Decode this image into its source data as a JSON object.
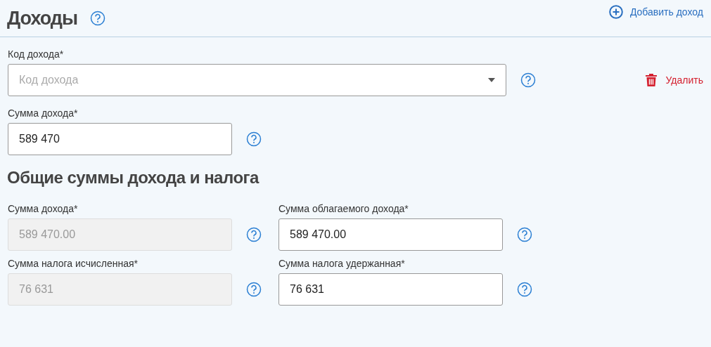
{
  "header": {
    "title": "Доходы",
    "add_button": "Добавить доход"
  },
  "income": {
    "code": {
      "label": "Код дохода*",
      "placeholder": "Код дохода"
    },
    "delete_button": "Удалить",
    "amount": {
      "label": "Сумма дохода*",
      "value": "589 470"
    }
  },
  "totals": {
    "title": "Общие суммы дохода и налога",
    "fields": [
      {
        "label": "Сумма дохода*",
        "value": "589 470.00",
        "disabled": true
      },
      {
        "label": "Сумма облагаемого дохода*",
        "value": "589 470.00",
        "disabled": false
      },
      {
        "label": "Сумма налога исчисленная*",
        "value": "76 631",
        "disabled": true
      },
      {
        "label": "Сумма налога удержанная*",
        "value": "76 631",
        "disabled": false
      }
    ]
  }
}
